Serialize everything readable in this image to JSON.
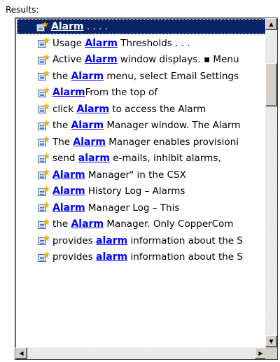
{
  "caption": "Results:",
  "keyword": "Alarm",
  "results": [
    {
      "pre": "",
      "kw": "Alarm",
      "post": " . . . .",
      "selected": true
    },
    {
      "pre": "Usage ",
      "kw": "Alarm",
      "post": " Thresholds . . ."
    },
    {
      "pre": "Active ",
      "kw": "Alarm",
      "post": " window displays. ▪ Menu"
    },
    {
      "pre": "the ",
      "kw": "Alarm",
      "post": " menu, select Email Settings"
    },
    {
      "pre": "",
      "kw": "Alarm",
      "post": "From the top of"
    },
    {
      "pre": "click ",
      "kw": "Alarm",
      "post": " to access the Alarm"
    },
    {
      "pre": "the ",
      "kw": "Alarm",
      "post": " Manager window. The Alarm"
    },
    {
      "pre": "The ",
      "kw": "Alarm",
      "post": " Manager enables provisioni"
    },
    {
      "pre": "send ",
      "kw": "alarm",
      "post": " e-mails, inhibit alarms,"
    },
    {
      "pre": "",
      "kw": "Alarm",
      "post": " Manager\" in the CSX"
    },
    {
      "pre": "",
      "kw": "Alarm",
      "post": " History Log – Alarms"
    },
    {
      "pre": "",
      "kw": "Alarm",
      "post": " Manager Log – This"
    },
    {
      "pre": "the ",
      "kw": "Alarm",
      "post": " Manager. Only CopperCom"
    },
    {
      "pre": "provides ",
      "kw": "alarm",
      "post": " information about the S"
    },
    {
      "pre": "provides ",
      "kw": "alarm",
      "post": " information about the S"
    }
  ],
  "icons": {
    "result_icon": "page-with-star-icon",
    "scroll_up": "▲",
    "scroll_down": "▼",
    "scroll_left": "◀",
    "scroll_right": "▶"
  },
  "colors": {
    "selection": "#0a246a",
    "keyword": "#0000ff",
    "chrome": "#d4d0c8"
  },
  "scroll": {
    "vertical_position": 0.05,
    "horizontal_position": 0
  }
}
